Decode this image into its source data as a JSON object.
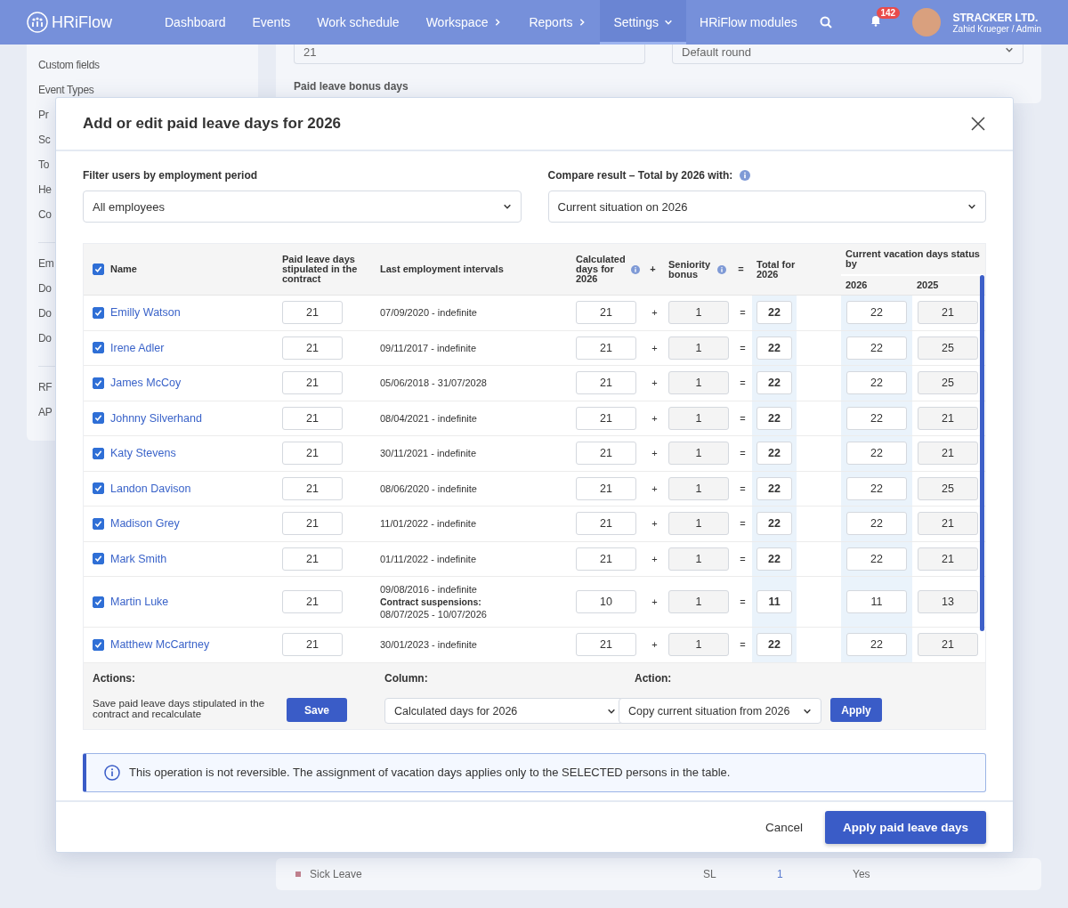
{
  "nav": {
    "logo": "HRiFlow",
    "items": [
      {
        "label": "Dashboard",
        "selected": false,
        "kind": "link"
      },
      {
        "label": "Events",
        "selected": false,
        "kind": "link"
      },
      {
        "label": "Work schedule",
        "selected": false,
        "kind": "link"
      },
      {
        "label": "Workspace",
        "selected": false,
        "kind": "submenu"
      },
      {
        "label": "Reports",
        "selected": false,
        "kind": "submenu"
      },
      {
        "label": "Settings",
        "selected": true,
        "kind": "dropdown"
      },
      {
        "label": "HRiFlow modules",
        "selected": false,
        "kind": "link"
      }
    ],
    "notifications": "142",
    "company": "STRACKER LTD.",
    "user": "Zahid Krueger / Admin"
  },
  "sidebar": {
    "groups": [
      {
        "items": [
          {
            "label": "Custom fields"
          },
          {
            "label": "Event Types"
          },
          {
            "label": "Pr"
          },
          {
            "label": "Sc"
          },
          {
            "label": "To"
          },
          {
            "label": "He"
          },
          {
            "label": "Co"
          }
        ]
      },
      {
        "items": [
          {
            "label": "Em"
          },
          {
            "label": "Do"
          },
          {
            "label": "Do"
          },
          {
            "label": "Do"
          }
        ]
      },
      {
        "items": [
          {
            "label": "RF"
          },
          {
            "label": "AP"
          }
        ]
      }
    ]
  },
  "background": {
    "days_value": "21",
    "rounding_value": "Default round",
    "bonus_label": "Paid leave bonus days",
    "leave_row": {
      "name": "Sick Leave",
      "color": "#c0808e",
      "code": "SL",
      "count": "1",
      "paid": "Yes"
    }
  },
  "modal": {
    "title": "Add or edit paid leave days for 2026",
    "filter": {
      "label": "Filter users by employment period",
      "value": "All employees"
    },
    "compare": {
      "label": "Compare result – Total by 2026 with:",
      "value": "Current situation on 2026"
    },
    "table": {
      "all_checked": true,
      "columns": {
        "name": "Name",
        "contract": "Paid leave days stipulated in the contract",
        "intervals": "Last employment intervals",
        "calculated": "Calculated days for 2026",
        "plus": "+",
        "seniority": "Seniority bonus",
        "equals": "=",
        "total": "Total for 2026",
        "current": "Current vacation days status by",
        "year_a": "2026",
        "year_b": "2025"
      },
      "rows": [
        {
          "checked": true,
          "name": "Emilly Watson",
          "contract": "21",
          "interval": "07/09/2020 - indefinite",
          "calculated": "21",
          "plus": "+",
          "seniority": "1",
          "equals": "=",
          "total": "22",
          "current": "22",
          "previous": "21"
        },
        {
          "checked": true,
          "name": "Irene Adler",
          "contract": "21",
          "interval": "09/11/2017 - indefinite",
          "calculated": "21",
          "plus": "+",
          "seniority": "1",
          "equals": "=",
          "total": "22",
          "current": "22",
          "previous": "25"
        },
        {
          "checked": true,
          "name": "James McCoy",
          "contract": "21",
          "interval": "05/06/2018 - 31/07/2028",
          "calculated": "21",
          "plus": "+",
          "seniority": "1",
          "equals": "=",
          "total": "22",
          "current": "22",
          "previous": "25"
        },
        {
          "checked": true,
          "name": "Johnny Silverhand",
          "contract": "21",
          "interval": "08/04/2021 - indefinite",
          "calculated": "21",
          "plus": "+",
          "seniority": "1",
          "equals": "=",
          "total": "22",
          "current": "22",
          "previous": "21"
        },
        {
          "checked": true,
          "name": "Katy Stevens",
          "contract": "21",
          "interval": "30/11/2021 - indefinite",
          "calculated": "21",
          "plus": "+",
          "seniority": "1",
          "equals": "=",
          "total": "22",
          "current": "22",
          "previous": "21"
        },
        {
          "checked": true,
          "name": "Landon Davison",
          "contract": "21",
          "interval": "08/06/2020 - indefinite",
          "calculated": "21",
          "plus": "+",
          "seniority": "1",
          "equals": "=",
          "total": "22",
          "current": "22",
          "previous": "25"
        },
        {
          "checked": true,
          "name": "Madison Grey",
          "contract": "21",
          "interval": "11/01/2022 - indefinite",
          "calculated": "21",
          "plus": "+",
          "seniority": "1",
          "equals": "=",
          "total": "22",
          "current": "22",
          "previous": "21"
        },
        {
          "checked": true,
          "name": "Mark Smith",
          "contract": "21",
          "interval": "01/11/2022 - indefinite",
          "calculated": "21",
          "plus": "+",
          "seniority": "1",
          "equals": "=",
          "total": "22",
          "current": "22",
          "previous": "21"
        },
        {
          "checked": true,
          "name": "Martin Luke",
          "contract": "21",
          "interval": "09/08/2016 - indefinite",
          "suspension_label": "Contract suspensions:",
          "suspension": "08/07/2025 - 10/07/2026",
          "calculated": "10",
          "plus": "+",
          "seniority": "1",
          "equals": "=",
          "total": "11",
          "current": "11",
          "previous": "13"
        },
        {
          "checked": true,
          "name": "Matthew McCartney",
          "contract": "21",
          "interval": "30/01/2023 - indefinite",
          "calculated": "21",
          "plus": "+",
          "seniority": "1",
          "equals": "=",
          "total": "22",
          "current": "22",
          "previous": "21"
        }
      ]
    },
    "actions": {
      "label": "Actions:",
      "description": "Save paid leave days stipulated in the contract and recalculate",
      "save": "Save",
      "column_label": "Column:",
      "column_value": "Calculated days for 2026",
      "action_label": "Action:",
      "action_value": "Copy current situation from 2026",
      "apply": "Apply"
    },
    "notice": "This operation is not reversible. The assignment of vacation days applies only to the SELECTED persons in the table.",
    "cancel": "Cancel",
    "submit": "Apply paid leave days"
  }
}
